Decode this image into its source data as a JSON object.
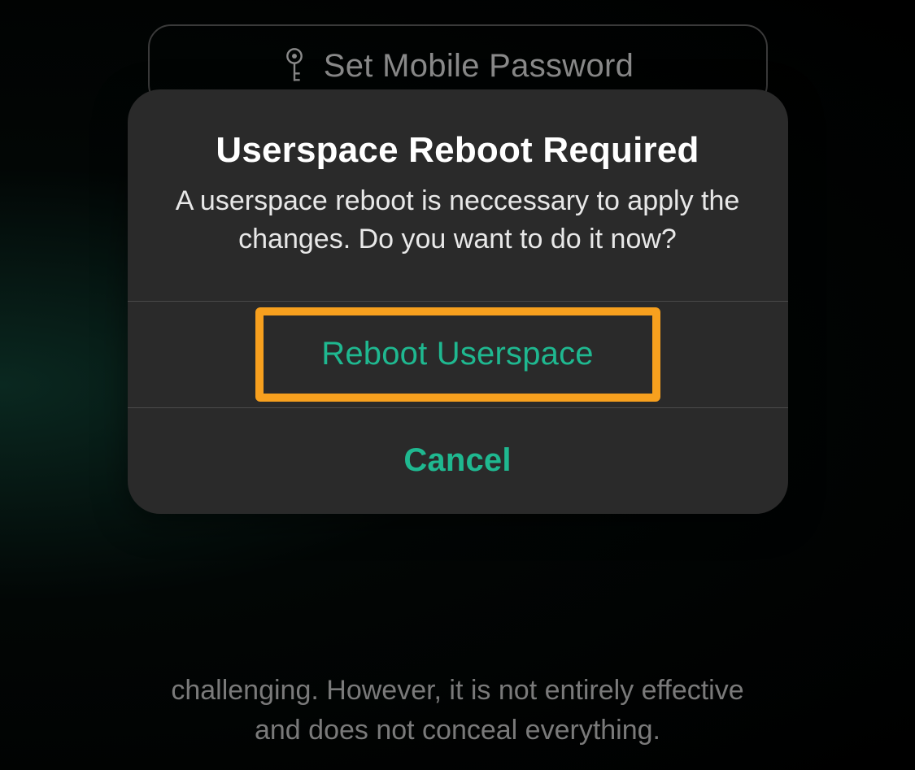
{
  "background": {
    "button": {
      "label": "Set Mobile Password"
    },
    "description_partial": "challenging. However, it is not entirely effective and does not conceal everything."
  },
  "dialog": {
    "title": "Userspace Reboot Required",
    "message": "A userspace reboot is neccessary to apply the changes. Do you want to do it now?",
    "primary_action": "Reboot Userspace",
    "cancel_action": "Cancel"
  },
  "colors": {
    "accent": "#1fb890",
    "highlight": "#f7a01e"
  }
}
